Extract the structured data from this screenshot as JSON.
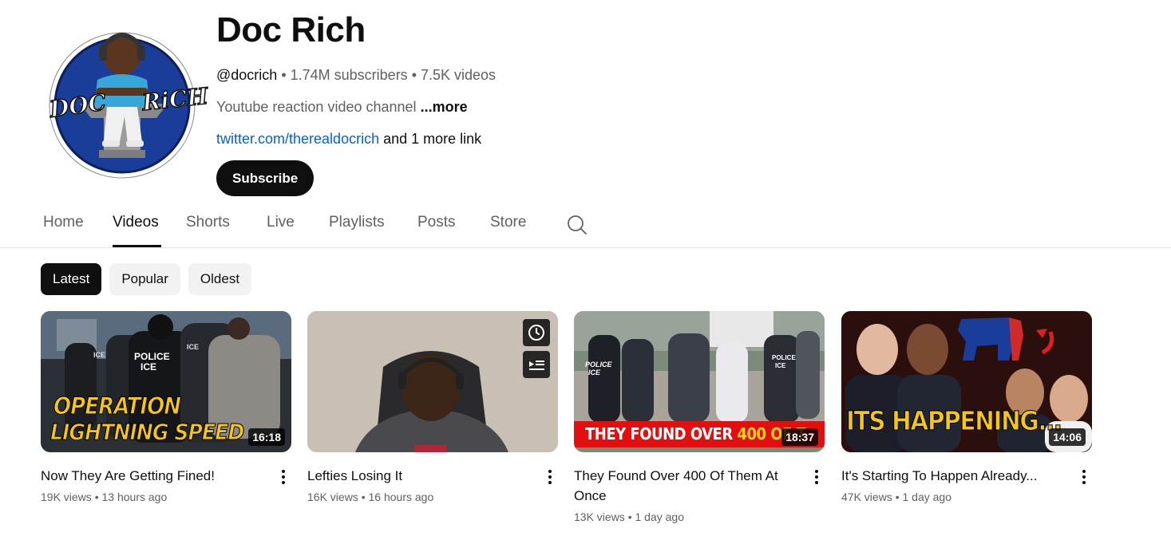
{
  "channel": {
    "name": "Doc Rich",
    "handle": "@docrich",
    "subscribers": "1.74M subscribers",
    "video_count": "7.5K videos",
    "separator": " • ",
    "description": "Youtube reaction video channel",
    "more_label": "...more",
    "link": "twitter.com/therealdocrich",
    "extra_links": "and 1 more link",
    "subscribe_label": "Subscribe",
    "avatar_text_left": "DOC",
    "avatar_text_right": "RiCH"
  },
  "tabs": [
    "Home",
    "Videos",
    "Shorts",
    "Live",
    "Playlists",
    "Posts",
    "Store"
  ],
  "active_tab": "Videos",
  "chips": [
    "Latest",
    "Popular",
    "Oldest"
  ],
  "active_chip": "Latest",
  "videos": [
    {
      "title": "Now They Are Getting Fined!",
      "views": "19K views",
      "age": "13 hours ago",
      "duration": "16:18",
      "thumb_text": [
        "OPERATION",
        "LIGHTNING SPEED"
      ],
      "thumb_labels": [
        "POLICE",
        "ICE",
        "ICE",
        "ICE"
      ]
    },
    {
      "title": "Lefties Losing It",
      "views": "16K views",
      "age": "16 hours ago",
      "duration": "",
      "icons": [
        "watch-later-icon",
        "add-to-queue-icon"
      ]
    },
    {
      "title": "They Found Over 400 Of Them At Once",
      "views": "13K views",
      "age": "1 day ago",
      "duration": "18:37",
      "banner_text": "THEY FOUND OVER ",
      "banner_highlight": "400 OF T",
      "thumb_labels": [
        "POLICE",
        "ICE",
        "POLICE",
        "ICE"
      ]
    },
    {
      "title": "It's Starting To Happen Already...",
      "views": "47K views",
      "age": "1 day ago",
      "duration": "14:06",
      "thumb_text": [
        "ITS HAPPENING..."
      ]
    }
  ],
  "colors": {
    "link": "#065fd4",
    "banner_red": "#e10f0f",
    "banner_yellow": "#ffd21a",
    "avatar_blue": "#1a3d9a",
    "thumb_yellow": "#f5c518"
  }
}
